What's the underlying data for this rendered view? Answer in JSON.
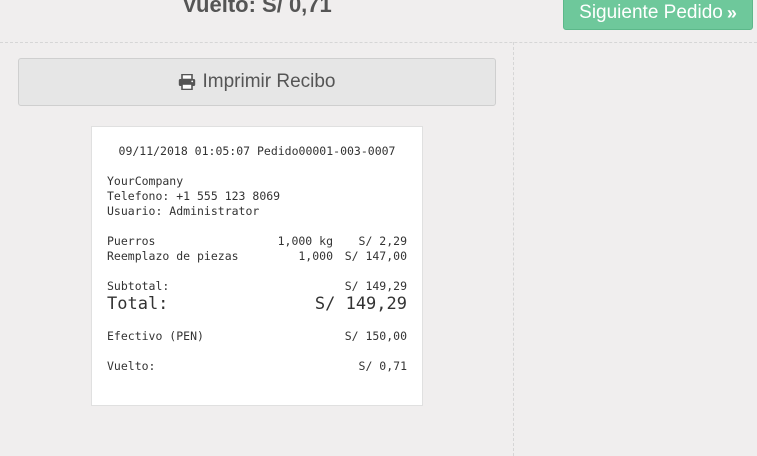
{
  "header": {
    "change_title": "Vuelto: S/ 0,71",
    "next_order_label": "Siguiente Pedido"
  },
  "print": {
    "label": "Imprimir Recibo"
  },
  "receipt": {
    "header_line": "09/11/2018 01:05:07 Pedido00001-003-0007",
    "company": "YourCompany",
    "phone": "Telefono: +1 555 123 8069",
    "user": "Usuario: Administrator",
    "lines": [
      {
        "name": "Puerros",
        "qty": "1,000 kg",
        "price": "S/ 2,29"
      },
      {
        "name": "Reemplazo de piezas",
        "qty": "1,000",
        "price": "S/ 147,00"
      }
    ],
    "subtotal_label": "Subtotal:",
    "subtotal_value": "S/ 149,29",
    "total_label": "Total:",
    "total_value": "S/ 149,29",
    "payment_label": "Efectivo (PEN)",
    "payment_value": "S/ 150,00",
    "change_label": "Vuelto:",
    "change_value": "S/ 0,71"
  },
  "colors": {
    "accent": "#6ec89b",
    "background": "#f0eeee"
  },
  "icons": {
    "print": "print-icon",
    "next": "chevron-double-right-icon"
  }
}
